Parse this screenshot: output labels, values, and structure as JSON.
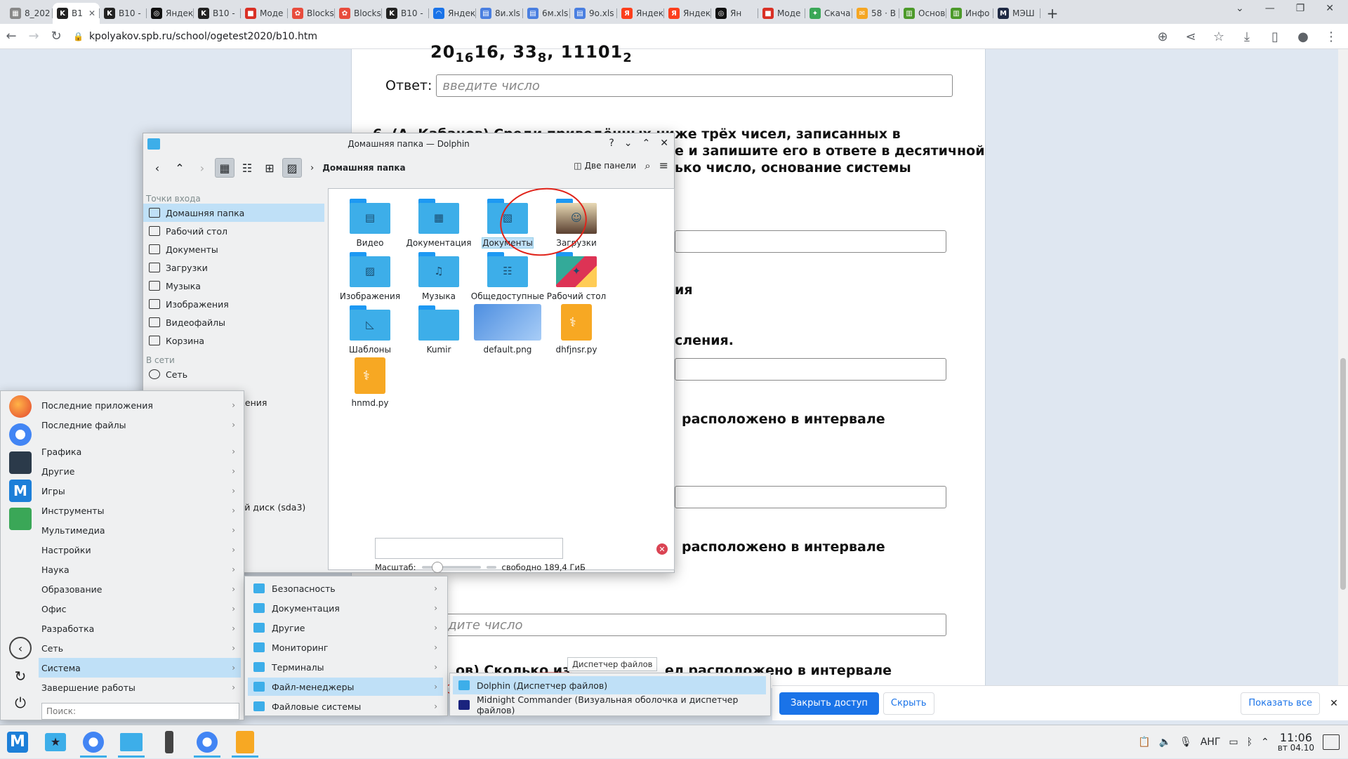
{
  "browser": {
    "tabs": [
      {
        "label": "8_202",
        "color": "#888888",
        "glyph": "▦"
      },
      {
        "label": "B1",
        "color": "#222222",
        "glyph": "K",
        "active": true
      },
      {
        "label": "B10 -",
        "color": "#222222",
        "glyph": "K"
      },
      {
        "label": "Яндек",
        "color": "#111111",
        "glyph": "◎"
      },
      {
        "label": "B10 -",
        "color": "#222222",
        "glyph": "K"
      },
      {
        "label": "Моде",
        "color": "#d93025",
        "glyph": "■"
      },
      {
        "label": "Blocks",
        "color": "#e84c3d",
        "glyph": "✿"
      },
      {
        "label": "Blocks",
        "color": "#e84c3d",
        "glyph": "✿"
      },
      {
        "label": "B10 -",
        "color": "#222222",
        "glyph": "K"
      },
      {
        "label": "Яндек",
        "color": "#1a73e8",
        "glyph": "◠"
      },
      {
        "label": "8и.xls",
        "color": "#4a7fe0",
        "glyph": "▤"
      },
      {
        "label": "6м.xls",
        "color": "#4a7fe0",
        "glyph": "▤"
      },
      {
        "label": "9о.xls",
        "color": "#4a7fe0",
        "glyph": "▤"
      },
      {
        "label": "Яндек",
        "color": "#fc3f1d",
        "glyph": "Я"
      },
      {
        "label": "Яндек",
        "color": "#fc3f1d",
        "glyph": "Я"
      },
      {
        "label": "Ян",
        "color": "#111111",
        "glyph": "◎"
      },
      {
        "label": "Моде",
        "color": "#d93025",
        "glyph": "■"
      },
      {
        "label": "Скача",
        "color": "#3aa757",
        "glyph": "✦"
      },
      {
        "label": "58 · В",
        "color": "#f5a623",
        "glyph": "✉"
      },
      {
        "label": "Основ",
        "color": "#4c9a2a",
        "glyph": "▥"
      },
      {
        "label": "Инфо",
        "color": "#4c9a2a",
        "glyph": "▥"
      },
      {
        "label": "МЭШ",
        "color": "#1f2a44",
        "glyph": "M"
      }
    ],
    "url": "kpolyakov.spb.ru/school/ogetest2020/b10.htm"
  },
  "page": {
    "top_formula": "20",
    "top_formula_rest": "16, 33",
    "top_formula_base8": "8",
    "top_formula_bin": ", 11101",
    "top_formula_base2": "2",
    "answer_label": "Ответ:",
    "answer_placeholder": "введите число",
    "q6_line1": "6. (А. Кабанов) Среди приведённых ниже трёх чисел, записанных в различных",
    "q6_line2": "е и запишите его в ответе в десятичной",
    "q6_line3": "ько число, основание системы",
    "frag_ya": "ия",
    "frag_sleniya": "сления.",
    "frag_interval1": "расположено в интервале",
    "frag_interval2": "расположено в интервале",
    "frag_q_last": "ов) Сколько из",
    "frag_interval3": "ел расположено в интервале"
  },
  "sharebar": {
    "grant": "Закрыть доступ",
    "hide": "Скрыть",
    "show_all": "Показать все"
  },
  "dolphin": {
    "title": "Домашняя папка — Dolphin",
    "breadcrumb": "Домашняя папка",
    "two_panels": "Две панели",
    "places_heading": "Точки входа",
    "places": [
      "Домашняя папка",
      "Рабочий стол",
      "Документы",
      "Загрузки",
      "Музыка",
      "Изображения",
      "Видеофайлы",
      "Корзина"
    ],
    "network_heading": "В сети",
    "network": [
      "Сеть"
    ],
    "partial_item": "ложения",
    "disk_item": "нный диск (sda3)",
    "files": [
      {
        "name": "Видео",
        "kind": "folder",
        "glyph": "▤"
      },
      {
        "name": "Документация",
        "kind": "folder",
        "glyph": "▦"
      },
      {
        "name": "Документы",
        "kind": "folder",
        "glyph": "▧"
      },
      {
        "name": "Загрузки",
        "kind": "folder-img",
        "glyph": "☺"
      },
      {
        "name": "Изображения",
        "kind": "folder",
        "glyph": "▨"
      },
      {
        "name": "Музыка",
        "kind": "folder",
        "glyph": "♫"
      },
      {
        "name": "Общедоступные",
        "kind": "folder",
        "glyph": "☷"
      },
      {
        "name": "Рабочий стол",
        "kind": "folder-desk",
        "glyph": "✦"
      },
      {
        "name": "Шаблоны",
        "kind": "folder",
        "glyph": "◺"
      },
      {
        "name": "Kumir",
        "kind": "folder",
        "glyph": ""
      },
      {
        "name": "default.png",
        "kind": "png",
        "glyph": ""
      },
      {
        "name": "dhfjnsr.py",
        "kind": "py",
        "glyph": "⚕"
      },
      {
        "name": "hnmd.py",
        "kind": "py",
        "glyph": "⚕"
      }
    ],
    "zoom_label": "Масштаб:",
    "free_space": "свободно 189,4 ГиБ"
  },
  "kicker": {
    "top": [
      "Последние приложения",
      "Последние файлы"
    ],
    "categories": [
      "Графика",
      "Другие",
      "Игры",
      "Инструменты",
      "Мультимедиа",
      "Настройки",
      "Наука",
      "Образование",
      "Офис",
      "Разработка",
      "Сеть",
      "Система",
      "Завершение работы"
    ],
    "search_placeholder": "Поиск:"
  },
  "submenu_system": [
    "Безопасность",
    "Документация",
    "Другие",
    "Мониторинг",
    "Терминалы",
    "Файл-менеджеры",
    "Файловые системы"
  ],
  "submenu_fm": {
    "tooltip": "Диспетчер файлов",
    "items": [
      "Dolphin (Диспетчер файлов)",
      "Midnight Commander (Визуальная оболочка и диспетчер файлов)"
    ]
  },
  "tray": {
    "lang": "АНГ",
    "time": "11:06",
    "date": "вт 04.10"
  }
}
